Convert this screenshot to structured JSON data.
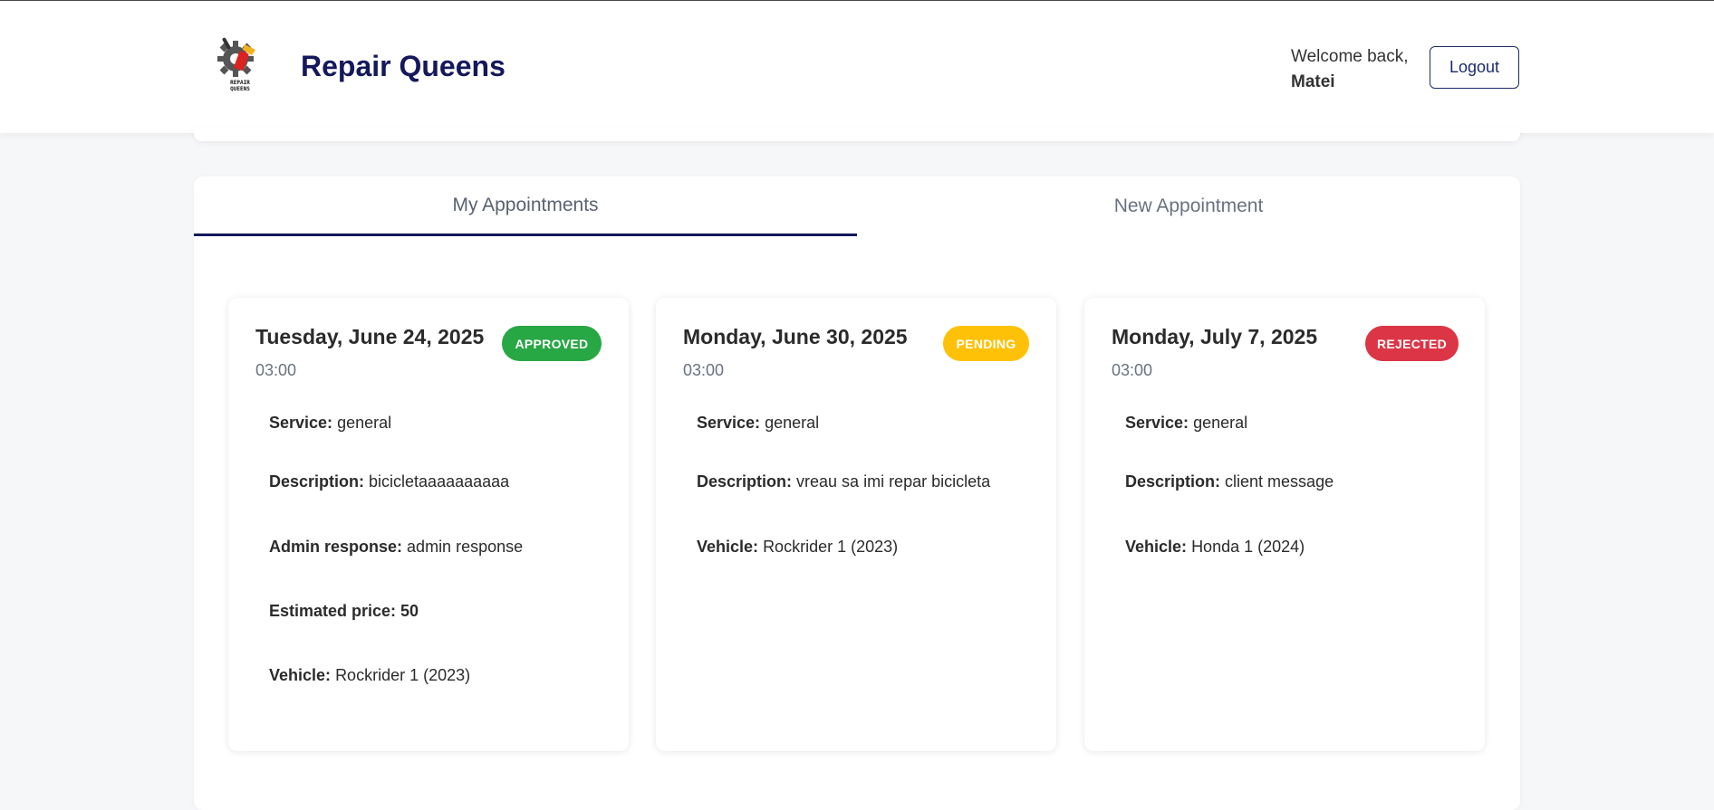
{
  "header": {
    "logo_text": "REPAIR QUEENS",
    "brand": "Repair Queens",
    "welcome": "Welcome back,",
    "user_name": "Matei",
    "logout_label": "Logout"
  },
  "tabs": [
    {
      "label": "My Appointments",
      "active": true
    },
    {
      "label": "New Appointment",
      "active": false
    }
  ],
  "colors": {
    "brand": "#14185c",
    "approved": "#28a745",
    "pending": "#ffc107",
    "rejected": "#dc3545"
  },
  "appointments": [
    {
      "date": "Tuesday, June 24, 2025",
      "time": "03:00",
      "status": "APPROVED",
      "service_label": "Service:",
      "service": "general",
      "description_label": "Description:",
      "description": "bicicletaaaaaaaaaa",
      "admin_response_label": "Admin response:",
      "admin_response": "admin response",
      "estimated_price_label": "Estimated price: 50",
      "vehicle_label": "Vehicle:",
      "vehicle": "Rockrider 1 (2023)"
    },
    {
      "date": "Monday, June 30, 2025",
      "time": "03:00",
      "status": "PENDING",
      "service_label": "Service:",
      "service": "general",
      "description_label": "Description:",
      "description": "vreau sa imi repar bicicleta",
      "vehicle_label": "Vehicle:",
      "vehicle": "Rockrider 1 (2023)"
    },
    {
      "date": "Monday, July 7, 2025",
      "time": "03:00",
      "status": "REJECTED",
      "service_label": "Service:",
      "service": "general",
      "description_label": "Description:",
      "description": "client message",
      "vehicle_label": "Vehicle:",
      "vehicle": "Honda 1 (2024)"
    }
  ]
}
